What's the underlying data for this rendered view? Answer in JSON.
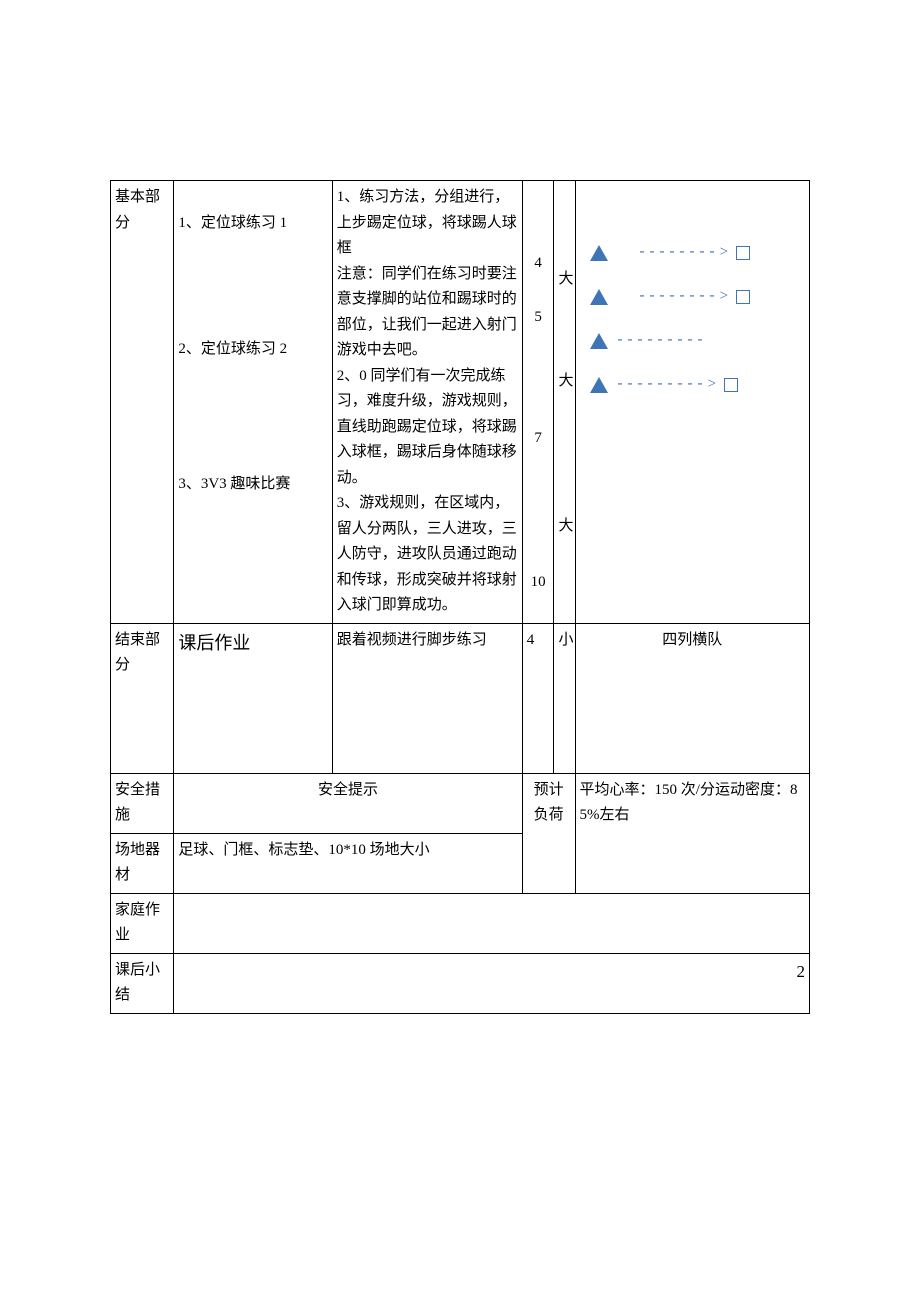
{
  "row1": {
    "label": "基本部分",
    "activities": {
      "a1": "1、定位球练习 1",
      "a2": "2、定位球练习 2",
      "a3": "3、3V3 趣味比赛"
    },
    "method": {
      "p1": "1、练习方法，分组进行，上步踢定位球，将球踢人球框",
      "p2": "注意：同学们在练习时要注意支撑脚的站位和踢球时的部位，让我们一起进入射门游戏中去吧。",
      "p3": "2、0 同学们有一次完成练习，难度升级，游戏规则，直线助跑踢定位球，将球踢入球框，踢球后身体随球移动。",
      "p4": "3、游戏规则，在区域内，留人分两队，三人进攻，三人防守，进攻队员通过跑动和传球，形成突破并将球射入球门即算成功。"
    },
    "nums": {
      "n1": "4",
      "n2": "5",
      "n3": "7",
      "n4": "10"
    },
    "intens": {
      "i1": "大",
      "i2": "大",
      "i3": "大"
    }
  },
  "row2": {
    "label": "结束部分",
    "activity": "课后作业",
    "method": "跟着视频进行脚步练习",
    "num": "4",
    "intens": "小",
    "formation": "四列横队"
  },
  "row3": {
    "label": "安全措施",
    "value": "安全提示"
  },
  "row4": {
    "label": "场地器材",
    "value": "足球、门框、标志垫、10*10 场地大小"
  },
  "load": {
    "label": "预计负荷",
    "value": "平均心率：150 次/分运动密度：85%左右"
  },
  "row5": {
    "label": "家庭作业"
  },
  "row6": {
    "label": "课后小结",
    "pgnum": "2"
  }
}
